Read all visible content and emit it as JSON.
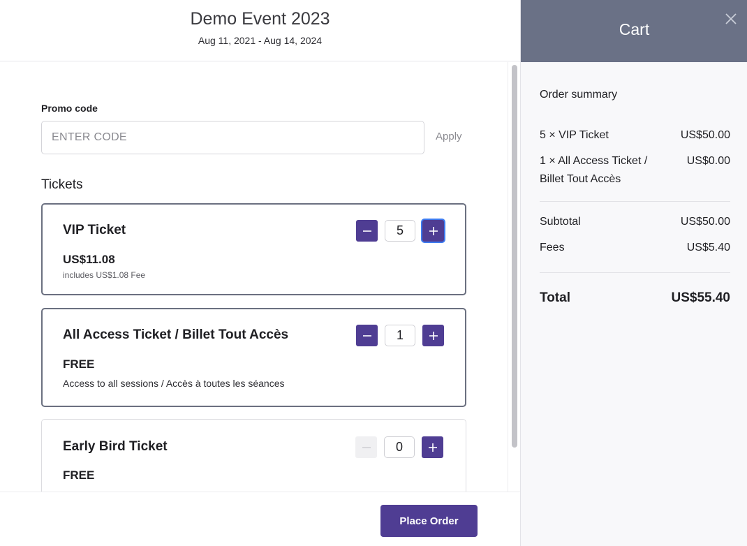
{
  "event": {
    "title": "Demo Event 2023",
    "dates": "Aug 11, 2021 - Aug 14, 2024"
  },
  "promo": {
    "label": "Promo code",
    "placeholder": "ENTER CODE",
    "apply_label": "Apply"
  },
  "tickets_heading": "Tickets",
  "tickets": [
    {
      "name": "VIP Ticket",
      "price": "US$11.08",
      "note": "includes US$1.08 Fee",
      "quantity": "5"
    },
    {
      "name": "All Access Ticket / Billet Tout Accès",
      "price": "FREE",
      "description": "Access to all sessions / Accès à toutes les séances",
      "quantity": "1"
    },
    {
      "name": "Early Bird Ticket",
      "price": "FREE",
      "quantity": "0"
    }
  ],
  "place_order_label": "Place Order",
  "cart": {
    "title": "Cart",
    "summary_heading": "Order summary",
    "items": [
      {
        "label": "5 × VIP Ticket",
        "amount": "US$50.00"
      },
      {
        "label_line1": "1 × All Access Ticket /",
        "label_line2": "Billet Tout Accès",
        "amount": "US$0.00"
      }
    ],
    "subtotal_label": "Subtotal",
    "subtotal": "US$50.00",
    "fees_label": "Fees",
    "fees": "US$5.40",
    "total_label": "Total",
    "total": "US$55.40"
  },
  "icons": {
    "minus": "minus-icon",
    "plus": "plus-icon",
    "close": "close-icon"
  },
  "colors": {
    "accent": "#4f3d93",
    "cart_header": "#6a7186",
    "focus_ring": "#3d7bf0"
  }
}
